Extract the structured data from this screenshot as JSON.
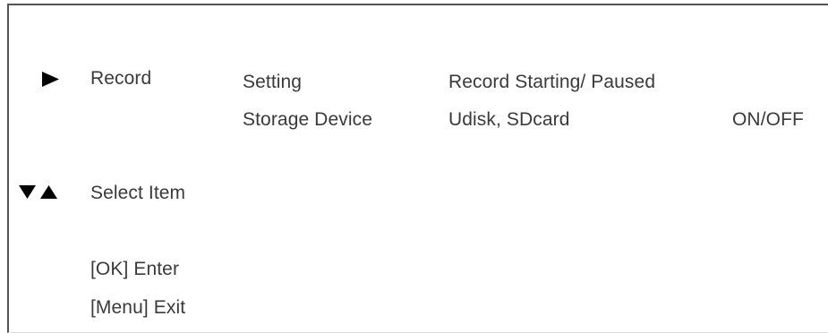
{
  "menu": {
    "record": {
      "icon": "play-right-triangle-icon",
      "label": "Record",
      "rows": [
        {
          "item": "Setting",
          "value": "Record Starting/ Paused",
          "state": ""
        },
        {
          "item": "Storage Device",
          "value": "Udisk, SDcard",
          "state": "ON/OFF"
        }
      ]
    },
    "select": {
      "icon": "down-up-triangles-icon",
      "label": "Select Item"
    },
    "keys": {
      "enter": "[OK] Enter",
      "exit": "[Menu] Exit"
    }
  },
  "colors": {
    "text": "#3a3a3a",
    "icon": "#000000",
    "border": "#555555"
  }
}
